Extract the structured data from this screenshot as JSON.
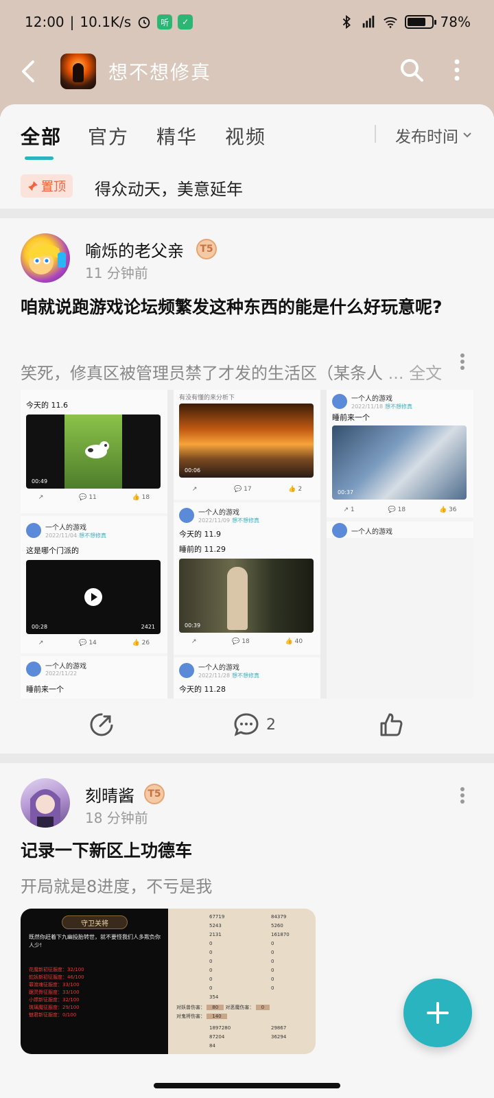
{
  "status_bar": {
    "time": "12:00",
    "net_speed": "10.1K/s",
    "battery": "78%"
  },
  "header": {
    "title": "想不想修真"
  },
  "tabs": [
    {
      "label": "全部",
      "active": true
    },
    {
      "label": "官方",
      "active": false
    },
    {
      "label": "精华",
      "active": false
    },
    {
      "label": "视频",
      "active": false
    }
  ],
  "sort": {
    "label": "发布时间"
  },
  "pinned": {
    "tag": "置顶",
    "text": "得众动天，美意延年"
  },
  "posts": [
    {
      "author": "喻烁的老父亲",
      "level": "T5",
      "time": "11 分钟前",
      "title": "咱就说跑游戏论坛频繁发这种东西的能是什么好玩意呢?",
      "excerpt": "笑死，修真区被管理员禁了才发的生活区（某条人",
      "more": "... 全文",
      "comments": "2",
      "collage": {
        "col1": [
          {
            "text": "今天的 11.6",
            "duration": "00:49",
            "likes": "18",
            "comments": "11"
          },
          {
            "user": "一个人的游戏",
            "date": "2022/11/04",
            "tag": "想不想修真",
            "text": "这是哪个门派的",
            "duration": "00:28",
            "views": "2421",
            "comments": "14",
            "likes": "26"
          },
          {
            "user": "一个人的游戏",
            "date": "2022/11/22",
            "text": "睡前来一个"
          }
        ],
        "col2": [
          {
            "text": "有没有懂的来分析下",
            "duration": "00:06",
            "comments": "17",
            "likes": "2"
          },
          {
            "user": "一个人的游戏",
            "date": "2022/11/09",
            "tag": "想不想修真",
            "text": "今天的 11.9",
            "text2": "睡前的 11.29",
            "duration": "00:39",
            "comments": "18",
            "likes": "40"
          },
          {
            "user": "一个人的游戏",
            "date": "2022/11/28",
            "tag": "想不想修真",
            "text": "今天的 11.28"
          }
        ],
        "col3": [
          {
            "user": "一个人的游戏",
            "date": "2022/11/18",
            "tag": "想不想修真",
            "text": "睡前来一个",
            "duration": "00:37",
            "shares": "1",
            "comments": "18",
            "likes": "36"
          },
          {
            "user": "一个人的游戏"
          }
        ]
      }
    },
    {
      "author": "刻晴酱",
      "level": "T5",
      "time": "18 分钟前",
      "title": "记录一下新区上功德车",
      "excerpt": "开局就是8进度，不亏是我",
      "game_screen": {
        "banner": "守卫关将",
        "dialog": "既然你赶着下九幽投胎转世，就不要怪我们人多欺负你人少!",
        "red_lines": [
          "花魔新初征服度：32/100",
          "蛇妖新初征服度：46/100",
          "罪渡魂征服度：33/100",
          "踞灵骨征服度：33/100",
          "小嫖新征服度：32/100",
          "琉璃魔征服度：29/100",
          "魅君新征服度：0/100"
        ],
        "stats_left": [
          "67719",
          "5243",
          "2131",
          "0",
          "0",
          "0",
          "0",
          "0",
          "0",
          "354"
        ],
        "stats_right": [
          "84379",
          "5260",
          "161870",
          "0",
          "0",
          "0",
          "0",
          "0",
          "0"
        ],
        "dmg_labels": [
          "对妖兽伤害：",
          "对恶魔伤害：",
          "对鬼将伤害："
        ],
        "dmg_values": [
          "80",
          "0",
          "140"
        ],
        "bottom_left": [
          "1897280",
          "87204",
          "84"
        ],
        "bottom_right": [
          "29867",
          "36294"
        ]
      }
    }
  ]
}
